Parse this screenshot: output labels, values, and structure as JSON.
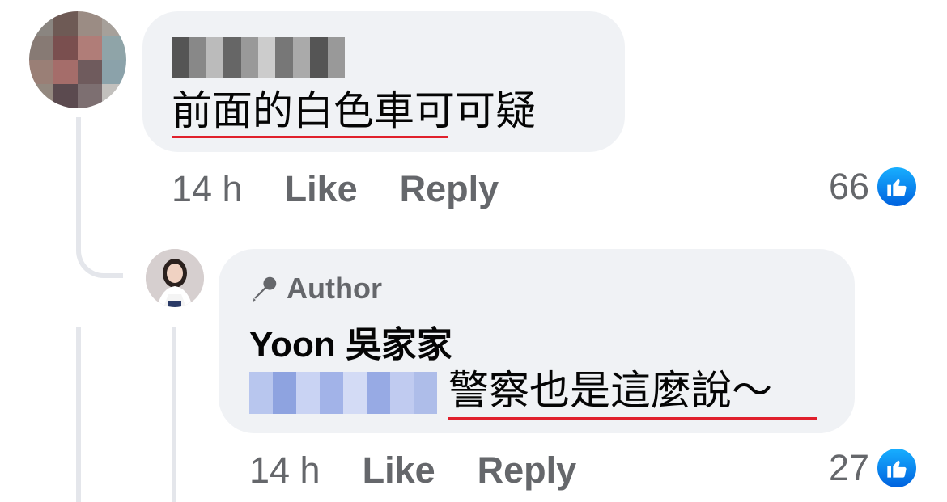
{
  "comment": {
    "text": "前面的白色車可可疑",
    "time": "14 h",
    "like_label": "Like",
    "reply_label": "Reply",
    "reaction_count": "66",
    "reaction_icon": "like-icon",
    "avatar_colors": [
      "#8a8580",
      "#6e5a55",
      "#9b8c84",
      "#a6a09a",
      "#877a74",
      "#7a4f4f",
      "#b07d78",
      "#8fa4a8",
      "#9a7f76",
      "#a56d6a",
      "#6f5b5d",
      "#8ba2aa",
      "#93887f",
      "#5b4a4f",
      "#7d6f71",
      "#c2c0bd"
    ],
    "name_blur_colors": [
      "#555",
      "#888",
      "#bbb",
      "#666",
      "#999",
      "#ccc",
      "#777",
      "#aaa",
      "#555",
      "#999"
    ]
  },
  "reply": {
    "badge_icon": "microphone-icon",
    "badge_label": "Author",
    "author_name": "Yoon 吳家家",
    "text": "警察也是這麼說～",
    "time": "14 h",
    "like_label": "Like",
    "reply_label": "Reply",
    "reaction_count": "27",
    "reaction_icon": "like-icon",
    "mention_blur_colors": [
      "#b8c6ee",
      "#8ea3e0",
      "#c9d3f3",
      "#a2b3e8",
      "#d3dbf5",
      "#97aae4",
      "#c0cbf0",
      "#aebde9"
    ]
  },
  "colors": {
    "bubble": "#f0f2f5",
    "secondary_text": "#65676b",
    "primary_text": "#050505",
    "underline": "#e0202c",
    "like_blue": "#1877f2"
  }
}
